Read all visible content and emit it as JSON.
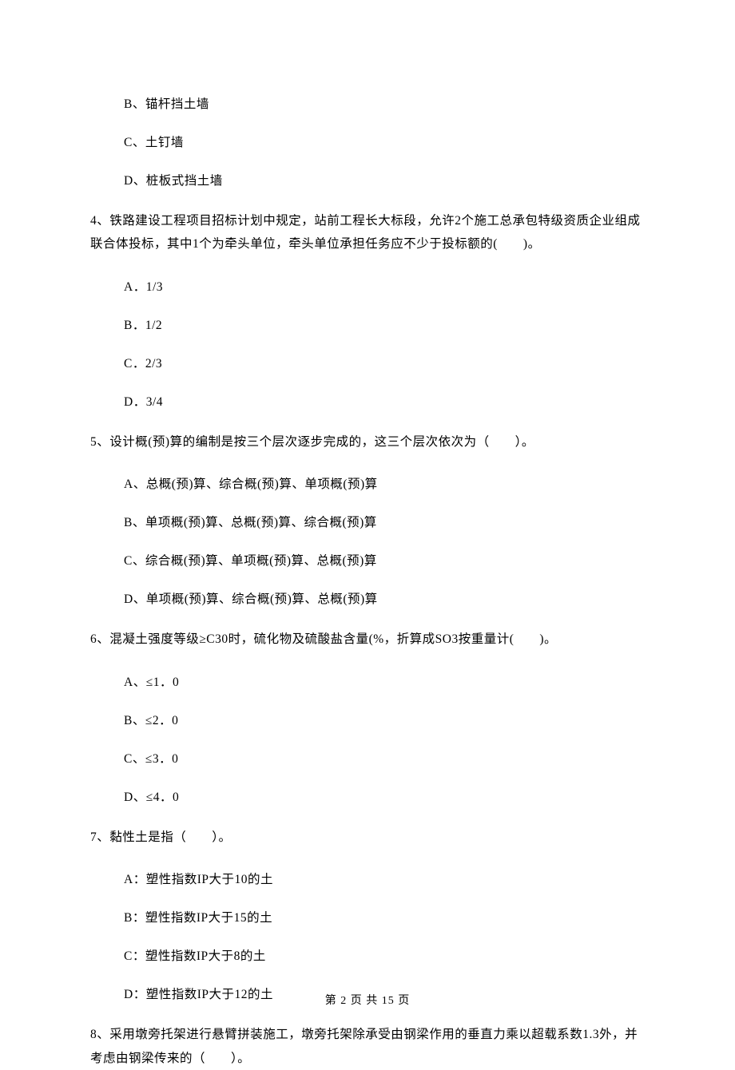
{
  "partialOptions": {
    "b": "B、锚杆挡土墙",
    "c": "C、土钉墙",
    "d": "D、桩板式挡土墙"
  },
  "q4": {
    "stem": "4、铁路建设工程项目招标计划中规定，站前工程长大标段，允许2个施工总承包特级资质企业组成联合体投标，其中1个为牵头单位，牵头单位承担任务应不少于投标额的(　　)。",
    "a": "A．1/3",
    "b": "B．1/2",
    "c": "C．2/3",
    "d": "D．3/4"
  },
  "q5": {
    "stem": "5、设计概(预)算的编制是按三个层次逐步完成的，这三个层次依次为（　　）。",
    "a": "A、总概(预)算、综合概(预)算、单项概(预)算",
    "b": "B、单项概(预)算、总概(预)算、综合概(预)算",
    "c": "C、综合概(预)算、单项概(预)算、总概(预)算",
    "d": "D、单项概(预)算、综合概(预)算、总概(预)算"
  },
  "q6": {
    "stem": "6、混凝土强度等级≥C30时，硫化物及硫酸盐含量(%，折算成SO3按重量计(　　)。",
    "a": "A、≤1．0",
    "b": "B、≤2．0",
    "c": "C、≤3．0",
    "d": "D、≤4．0"
  },
  "q7": {
    "stem": "7、黏性土是指（　　）。",
    "a": "A：塑性指数IP大于10的土",
    "b": "B：塑性指数IP大于15的土",
    "c": "C：塑性指数IP大于8的土",
    "d": "D：塑性指数IP大于12的土"
  },
  "q8": {
    "stem": "8、采用墩旁托架进行悬臂拼装施工，墩旁托架除承受由钢梁作用的垂直力乘以超载系数1.3外，并考虑由钢梁传来的（　　）。"
  },
  "footer": "第 2 页 共 15 页"
}
